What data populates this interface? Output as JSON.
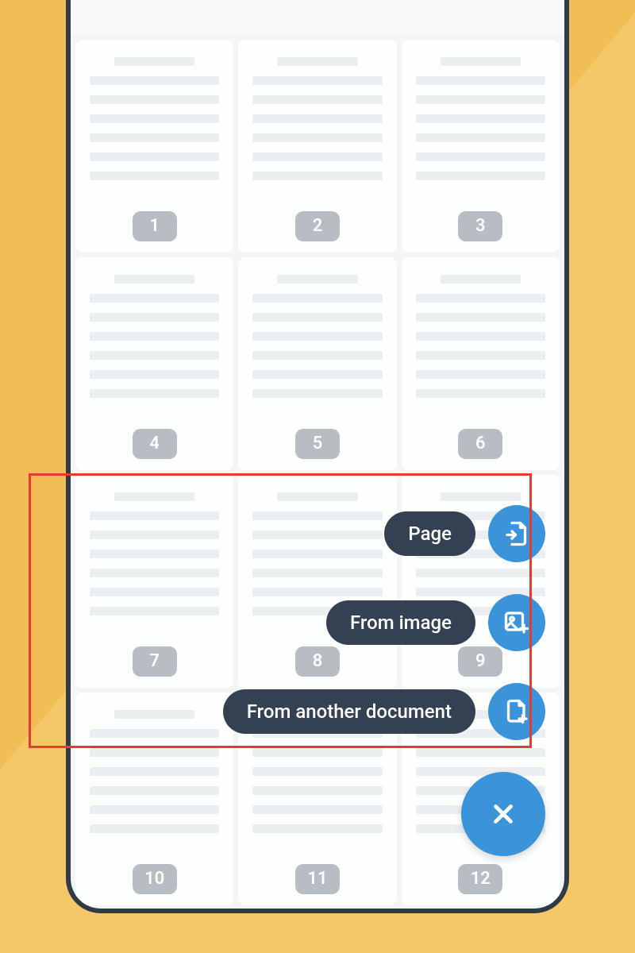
{
  "pages": [
    "1",
    "2",
    "3",
    "4",
    "5",
    "6",
    "7",
    "8",
    "9",
    "10",
    "11",
    "12"
  ],
  "menu": {
    "page": {
      "label": "Page",
      "icon": "page-arrow-icon"
    },
    "image": {
      "label": "From image",
      "icon": "image-plus-icon"
    },
    "document": {
      "label": "From another document",
      "icon": "file-plus-icon"
    }
  },
  "close_label": "Close",
  "colors": {
    "accent": "#3b94d9",
    "pill_bg": "#344152",
    "page_num_bg": "#b7bdc3",
    "highlight": "#e43b32"
  }
}
